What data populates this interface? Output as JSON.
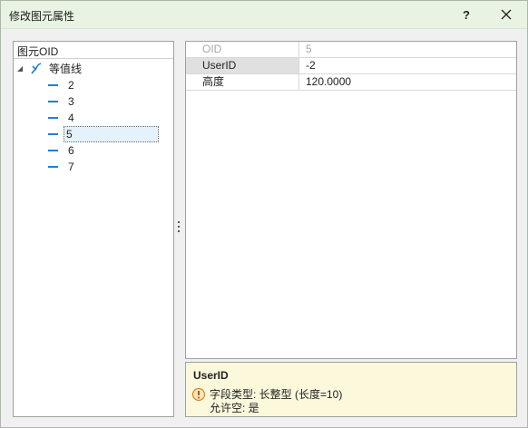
{
  "window": {
    "title": "修改图元属性",
    "help_label": "?"
  },
  "tree": {
    "header": "图元OID",
    "root": {
      "label": "等值线"
    },
    "items": [
      {
        "label": "2"
      },
      {
        "label": "3"
      },
      {
        "label": "4"
      },
      {
        "label": "5"
      },
      {
        "label": "6"
      },
      {
        "label": "7"
      }
    ],
    "selected": "5"
  },
  "properties": {
    "rows": [
      {
        "name": "OID",
        "value": "5"
      },
      {
        "name": "UserID",
        "value": "-2"
      },
      {
        "name": "高度",
        "value": "120.0000"
      }
    ],
    "selected": "UserID"
  },
  "description": {
    "title": "UserID",
    "line1": "字段类型: 长整型 (长度=10)",
    "line2": "允许空: 是"
  },
  "colors": {
    "titlebar": "#e8f3e3",
    "selection": "#e5f1fb",
    "tree_icon": "#1f7fd6",
    "description_bg": "#fbf8dc"
  }
}
